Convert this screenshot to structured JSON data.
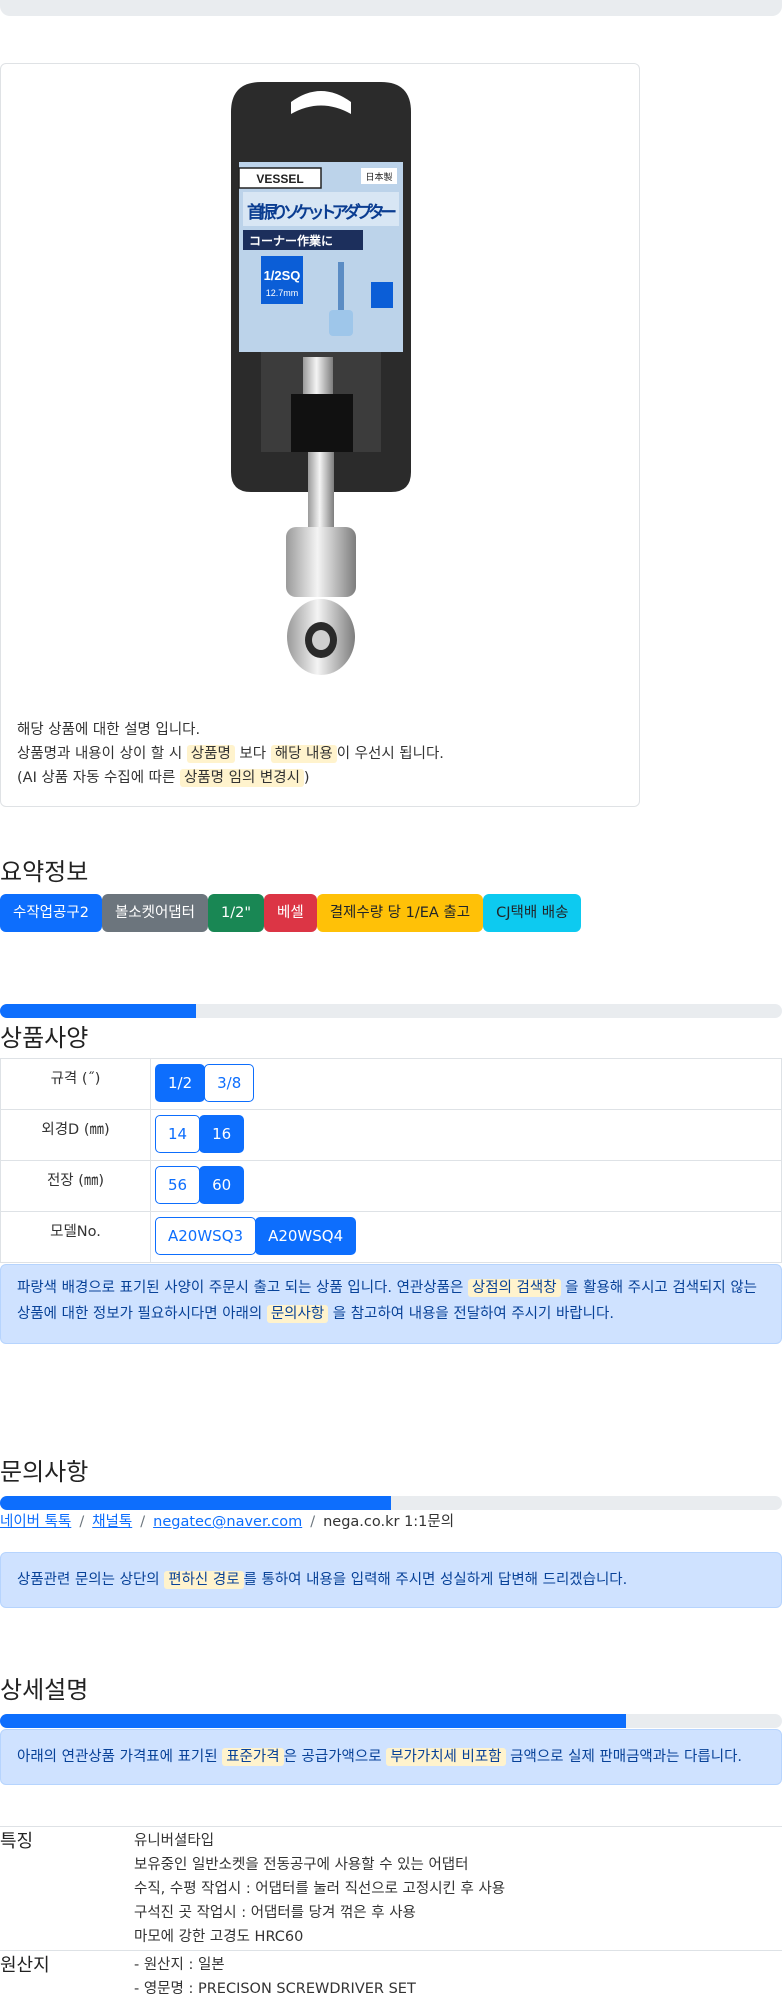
{
  "product": {
    "brand_logo": "VESSEL",
    "package_text_1": "首振りソケットアダプター",
    "package_text_2": "コーナー作業に",
    "package_made_in": "日本製",
    "size_label": "1/2SQ",
    "size_mm": "12.7mm",
    "notice_line1": "해당 상품에 대한 설명 입니다.",
    "notice_line2_a": "상품명과 내용이 상이 할 시 ",
    "notice_line2_hl1": "상품명",
    "notice_line2_b": " 보다 ",
    "notice_line2_hl2": "해당 내용",
    "notice_line2_c": "이 우선시 됩니다.",
    "notice_line3_a": "(AI 상품 자동 수집에 따른 ",
    "notice_line3_hl": "상품명 임의 변경시",
    "notice_line3_b": ")"
  },
  "summary": {
    "title": "요약정보",
    "badges": [
      {
        "label": "수작업공구2",
        "color": "#0d6efd"
      },
      {
        "label": "볼소켓어댑터",
        "color": "#6c757d"
      },
      {
        "label": "1/2\"",
        "color": "#198754"
      },
      {
        "label": "베셀",
        "color": "#dc3545"
      },
      {
        "label": "결제수량 당 1/EA 출고",
        "color": "#ffc107"
      },
      {
        "label": "CJ택배 배송",
        "color": "#0dcaf0"
      }
    ]
  },
  "specs": {
    "title": "상품사양",
    "progress": 0.25,
    "rows": [
      {
        "label": "규격 (˝)",
        "options": [
          {
            "text": "1/2",
            "selected": true
          },
          {
            "text": "3/8",
            "selected": false
          }
        ]
      },
      {
        "label": "외경D (㎜)",
        "options": [
          {
            "text": "14",
            "selected": false
          },
          {
            "text": "16",
            "selected": true
          }
        ]
      },
      {
        "label": "전장 (㎜)",
        "options": [
          {
            "text": "56",
            "selected": false
          },
          {
            "text": "60",
            "selected": true
          }
        ]
      },
      {
        "label": "모델No.",
        "options": [
          {
            "text": "A20WSQ3",
            "selected": false
          },
          {
            "text": "A20WSQ4",
            "selected": true
          }
        ]
      }
    ],
    "alert_a": "파랑색 배경으로 표기된 사양이 주문시 출고 되는 상품 입니다. 연관상품은 ",
    "alert_hl1": "상점의 검색창",
    "alert_b": " 을 활용해 주시고 검색되지 않는 상품에 대한 정보가 필요하시다면 아래의 ",
    "alert_hl2": "문의사항",
    "alert_c": " 을 참고하여 내용을 전달하여 주시기 바랍니다."
  },
  "inquiry": {
    "title": "문의사항",
    "progress": 0.5,
    "links": [
      "네이버 톡톡",
      "채널톡",
      "negatec@naver.com"
    ],
    "plain": "nega.co.kr 1:1문의",
    "alert_a": "상품관련 문의는 상단의 ",
    "alert_hl": "편하신 경로",
    "alert_b": "를 통하여 내용을 입력해 주시면 성실하게 답변해 드리겠습니다."
  },
  "detail": {
    "title": "상세설명",
    "progress": 0.8,
    "alert_a": "아래의 연관상품 가격표에 표기된 ",
    "alert_hl1": "표준가격",
    "alert_b": "은 공급가액으로 ",
    "alert_hl2": "부가가치세 비포함",
    "alert_c": " 금액으로 실제 판매금액과는 다릅니다.",
    "features_key": "특징",
    "features": [
      "유니버셜타입",
      "보유중인 일반소켓을 전동공구에 사용할 수 있는 어댑터",
      "수직, 수평 작업시 : 어댑터를 눌러 직선으로 고정시킨 후 사용",
      "구석진 곳 작업시 : 어댑터를 당겨 꺾은 후 사용",
      "마모에 강한 고경도 HRC60"
    ],
    "origin_key": "원산지",
    "origin": [
      "- 원산지 : 일본",
      "- 영문명 : PRECISON SCREWDRIVER SET"
    ]
  }
}
